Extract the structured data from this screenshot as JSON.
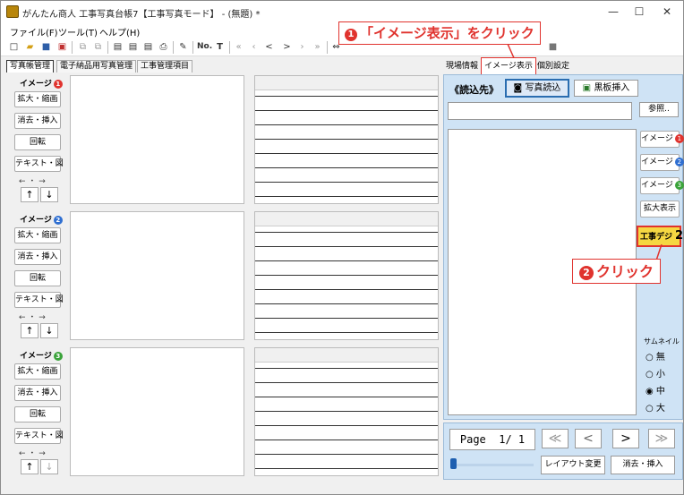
{
  "window": {
    "title": "がんたん商人 工事写真台帳7【工事写真モード】 - (無題) *",
    "minimize": "—",
    "maximize": "☐",
    "close": "✕"
  },
  "menu": [
    "ファイル(F)",
    "ツール(T)",
    "ヘルプ(H)"
  ],
  "callouts": {
    "one_num": "1",
    "one_text": "「イメージ表示」をクリック",
    "two_num": "2",
    "two_text": "クリック"
  },
  "toolbar": {
    "number_label": "No.",
    "font_label": "T"
  },
  "left_tabs": [
    "写真帳管理",
    "電子納品用写真管理",
    "工事管理項目"
  ],
  "groups": [
    {
      "label": "イメージ",
      "badge": "1",
      "zoom": "拡大・縮画",
      "erase": "消去・挿入",
      "rotate": "回転",
      "text": "テキスト・図",
      "arrows": "← ・ →",
      "up": "↑",
      "down": "↓"
    },
    {
      "label": "イメージ",
      "badge": "2",
      "zoom": "拡大・縮画",
      "erase": "消去・挿入",
      "rotate": "回転",
      "text": "テキスト・図",
      "arrows": "← ・ →",
      "up": "↑",
      "down": "↓"
    },
    {
      "label": "イメージ",
      "badge": "3",
      "zoom": "拡大・縮画",
      "erase": "消去・挿入",
      "rotate": "回転",
      "text": "テキスト・図",
      "arrows": "← ・ →",
      "up": "↑",
      "down": "↓"
    }
  ],
  "right_tabs": [
    "現場情報",
    "イメージ表示",
    "個別設定"
  ],
  "right_panel": {
    "source_label": "《読込先》",
    "photo_load": "写真読込",
    "board_insert": "黒板挿入",
    "browse": "参照..",
    "image_buttons": [
      {
        "label": "イメージ",
        "badge": "1"
      },
      {
        "label": "イメージ",
        "badge": "2"
      },
      {
        "label": "イメージ",
        "badge": "3"
      }
    ],
    "zoom_display": "拡大表示",
    "construction_button": "工事デジ",
    "construction_number": "2",
    "thumbnail_label": "サムネイル",
    "thumbnail_options": [
      "無",
      "小",
      "中",
      "大"
    ],
    "thumbnail_selected": "中"
  },
  "nav": {
    "page_text": "Page  1/ 1",
    "first": "≪",
    "prev": "<",
    "next": ">",
    "last": "≫",
    "layout_change": "レイアウト変更",
    "erase_insert": "消去・挿入"
  },
  "colors": {
    "accent_red": "#e0332e",
    "panel_blue": "#cfe3f5",
    "highlight_yellow": "#f5d742"
  }
}
